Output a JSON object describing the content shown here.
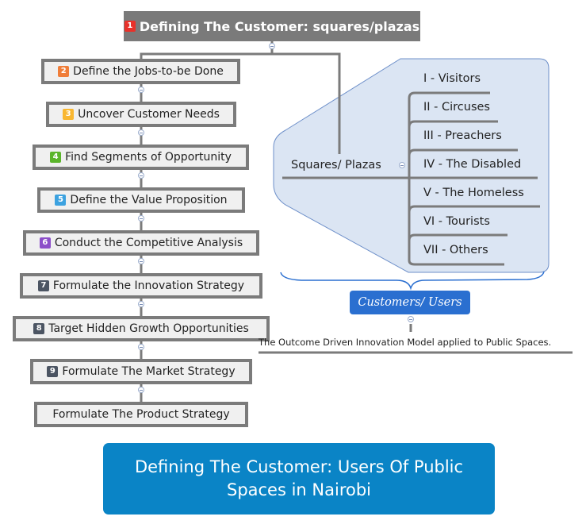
{
  "root": {
    "badge": "1",
    "badge_color": "#e8312a",
    "label": "Defining The Customer: squares/plazas"
  },
  "steps": [
    {
      "badge": "2",
      "badge_color": "#f07e3a",
      "label": "Define the Jobs-to-be Done"
    },
    {
      "badge": "3",
      "badge_color": "#f9b731",
      "label": "Uncover Customer Needs"
    },
    {
      "badge": "4",
      "badge_color": "#5bb52b",
      "label": "Find Segments of Opportunity"
    },
    {
      "badge": "5",
      "badge_color": "#3ca2e0",
      "label": "Define the Value Proposition"
    },
    {
      "badge": "6",
      "badge_color": "#8c4ec9",
      "label": "Conduct the Competitive Analysis"
    },
    {
      "badge": "7",
      "badge_color": "#4c5563",
      "label": "Formulate the Innovation Strategy"
    },
    {
      "badge": "8",
      "badge_color": "#4c5563",
      "label": "Target Hidden Growth Opportunities"
    },
    {
      "badge": "9",
      "badge_color": "#4c5563",
      "label": "Formulate The Market Strategy"
    },
    {
      "badge": "",
      "badge_color": "",
      "label": "Formulate The Product Strategy"
    }
  ],
  "branch": {
    "label": "Squares/ Plazas",
    "items": [
      "I -  Visitors",
      "II -  Circuses",
      "III -  Preachers",
      "IV -  The Disabled",
      "V -  The Homeless",
      "VI -  Tourists",
      "VII -  Others"
    ]
  },
  "summary": {
    "label": "Customers/ Users"
  },
  "caption": "The Outcome Driven Innovation Model applied to Public Spaces.",
  "title": {
    "line1": "Defining The Customer: Users Of Public",
    "line2": "Spaces in Nairobi"
  },
  "colors": {
    "line": "#7b7b7b",
    "boundary_fill": "#dbe5f3",
    "boundary_stroke": "#6d8fc9",
    "summary": "#2a6fd0",
    "title_bg": "#0a84c6"
  }
}
